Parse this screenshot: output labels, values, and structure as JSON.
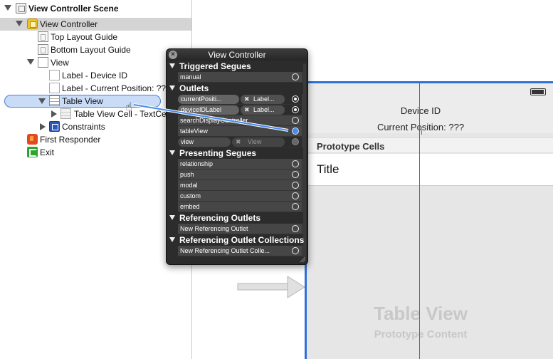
{
  "outline": {
    "items": [
      {
        "label": "View Controller Scene"
      },
      {
        "label": "View Controller"
      },
      {
        "label": "Top Layout Guide"
      },
      {
        "label": "Bottom Layout Guide"
      },
      {
        "label": "View"
      },
      {
        "label": "Label - Device ID"
      },
      {
        "label": "Label - Current Position: ??"
      },
      {
        "label": "Table View"
      },
      {
        "label": "Table View Cell - TextCe"
      },
      {
        "label": "Constraints"
      },
      {
        "label": "First Responder"
      },
      {
        "label": "Exit"
      }
    ]
  },
  "hud": {
    "title": "View Controller",
    "close_glyph": "×",
    "sections": {
      "triggered_segues": {
        "title": "Triggered Segues",
        "items": [
          "manual"
        ]
      },
      "outlets": {
        "title": "Outlets",
        "items": [
          {
            "name": "currentPositi...",
            "target": "Label..."
          },
          {
            "name": "deviceIDLabel",
            "target": "Label..."
          },
          {
            "name": "searchDisplayController"
          },
          {
            "name": "tableView"
          },
          {
            "name": "view",
            "target": "View"
          }
        ]
      },
      "presenting_segues": {
        "title": "Presenting Segues",
        "items": [
          "relationship",
          "push",
          "modal",
          "custom",
          "embed"
        ]
      },
      "referencing_outlets": {
        "title": "Referencing Outlets",
        "items": [
          "New Referencing Outlet"
        ]
      },
      "referencing_collections": {
        "title": "Referencing Outlet Collections",
        "items": [
          "New Referencing Outlet Colle..."
        ]
      }
    }
  },
  "canvas": {
    "device_id": "Device ID",
    "current_position": "Current Position: ???",
    "prototype_cells": "Prototype Cells",
    "cell_title": "Title",
    "table_view_big": "Table View",
    "table_view_small": "Prototype Content"
  },
  "colors": {
    "selection_blue": "#2f6fd8",
    "hud_bg": "#2c2c2c"
  }
}
